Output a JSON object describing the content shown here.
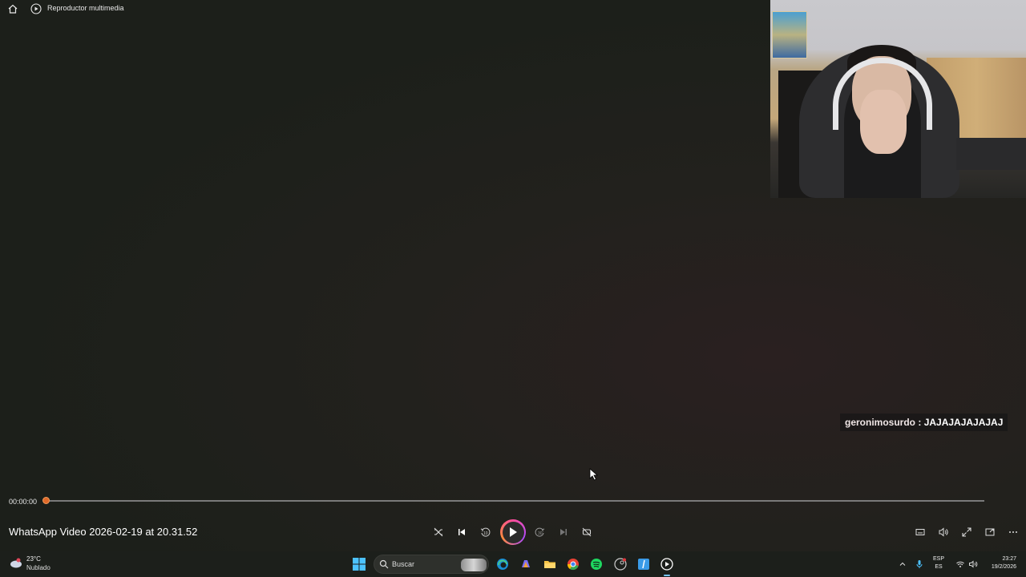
{
  "app": {
    "title": "Reproductor multimedia"
  },
  "overlay": {
    "chat_user": "geronimosurdo",
    "chat_separator": " : ",
    "chat_message": "JAJAJAJAJAJAJ"
  },
  "player": {
    "current_time": "00:00:00",
    "progress_fraction": 0.0,
    "video_title": "WhatsApp Video 2026-02-19 at 20.31.52",
    "accent_color": "#e06a2a"
  },
  "taskbar": {
    "weather_temp": "23°C",
    "weather_condition": "Nublado",
    "search_placeholder": "Buscar",
    "lang_primary": "ESP",
    "lang_secondary": "ES",
    "time": "23:27",
    "date": "19/2/2026",
    "icons": [
      "windows-start-icon",
      "search-icon",
      "edge-icon",
      "copilot-icon",
      "file-explorer-icon",
      "chrome-icon",
      "spotify-icon",
      "steam-icon",
      "store-app-icon",
      "media-player-icon"
    ]
  }
}
